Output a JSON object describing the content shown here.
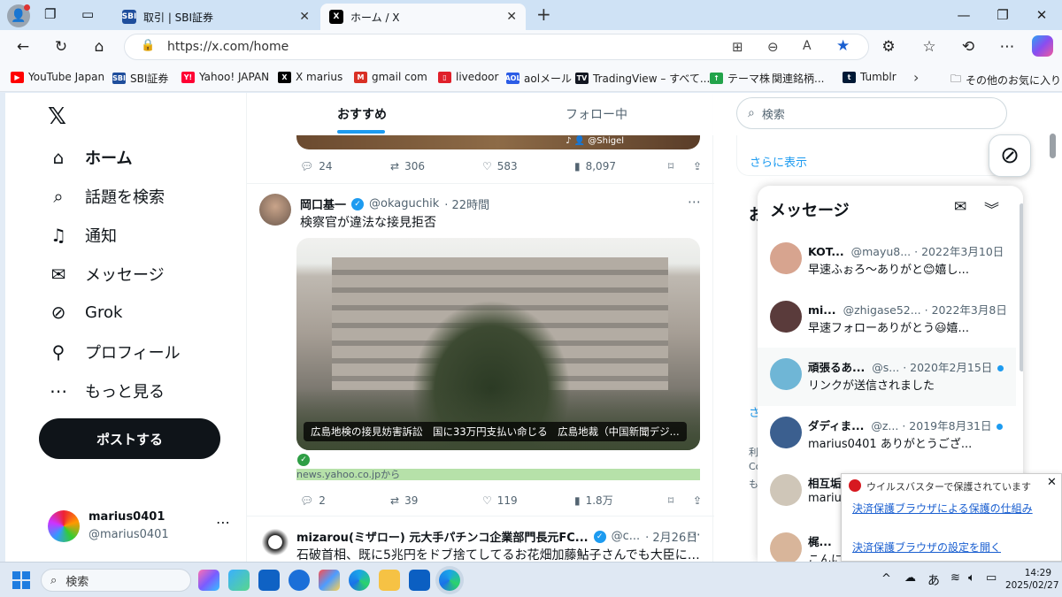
{
  "browser": {
    "tabs": [
      {
        "label": "取引 | SBI証券",
        "fav": "SBI"
      },
      {
        "label": "ホーム / X",
        "fav": "X"
      }
    ],
    "url": "https://x.com/home",
    "favorites": [
      {
        "label": "YouTube Japan",
        "icon": "youtube-icon",
        "color": "#ff0000",
        "glyph": "▶"
      },
      {
        "label": "SBI証券",
        "icon": "sbi-icon",
        "color": "#1f4e9c",
        "glyph": "SBI"
      },
      {
        "label": "Yahoo! JAPAN",
        "icon": "yahoo-icon",
        "color": "#ff0033",
        "glyph": "Y!"
      },
      {
        "label": "X marius",
        "icon": "x-icon",
        "color": "#000000",
        "glyph": "X"
      },
      {
        "label": "gmail com",
        "icon": "gmail-icon",
        "color": "#d93025",
        "glyph": "M"
      },
      {
        "label": "livedoor",
        "icon": "livedoor-icon",
        "color": "#e0202a",
        "glyph": "▯"
      },
      {
        "label": "aolメール",
        "icon": "aol-icon",
        "color": "#2b5ce6",
        "glyph": "AOL"
      },
      {
        "label": "TradingView – すべて...",
        "icon": "tradingview-icon",
        "color": "#131722",
        "glyph": "TV"
      },
      {
        "label": "テーマ株",
        "icon": "theme-stock-icon",
        "color": "#22a34a",
        "glyph": "↑"
      },
      {
        "label": "関連銘柄...",
        "icon": "",
        "color": "",
        "glyph": ""
      },
      {
        "label": "Tumblr",
        "icon": "tumblr-icon",
        "color": "#001935",
        "glyph": "t"
      }
    ],
    "other_favorites": "その他のお気に入り"
  },
  "sidebar": {
    "items": [
      {
        "label": "ホーム",
        "icon": "home-icon",
        "glyph": "⌂"
      },
      {
        "label": "話題を検索",
        "icon": "search-icon",
        "glyph": "⌕"
      },
      {
        "label": "通知",
        "icon": "bell-icon",
        "glyph": "♫"
      },
      {
        "label": "メッセージ",
        "icon": "mail-icon",
        "glyph": "✉"
      },
      {
        "label": "Grok",
        "icon": "grok-icon",
        "glyph": "⊘"
      },
      {
        "label": "プロフィール",
        "icon": "person-icon",
        "glyph": "⚲"
      },
      {
        "label": "もっと見る",
        "icon": "more-circle-icon",
        "glyph": "⋯"
      }
    ],
    "post_button": "ポストする",
    "account": {
      "name": "marius0401",
      "handle": "@marius0401"
    }
  },
  "feed": {
    "tabs": [
      "おすすめ",
      "フォロー中"
    ],
    "prev_post": {
      "watermark": "♪ 👤 @Shigel",
      "replies": "24",
      "reposts": "306",
      "likes": "583",
      "views": "8,097"
    },
    "post1": {
      "name": "岡口基一",
      "handle": "@okaguchik",
      "time": "· 22時間",
      "text": "検察官が違法な接見拒否",
      "card_caption": "広島地検の接見妨害訴訟　国に33万円支払い命じる　広島地裁（中国新聞デジ...",
      "card_source": "news.yahoo.co.jpから",
      "replies": "2",
      "reposts": "39",
      "likes": "119",
      "views": "1.8万"
    },
    "post2": {
      "name": "mizarou(ミザロー) 元大手パチンコ企業部門長元FC...",
      "handle": "@c...",
      "time": "· 2月26日",
      "text": "石破首相、既に5兆円をドブ捨てしてるお花畑加藤鮎子さんでも大臣に居座れ"
    }
  },
  "right": {
    "search_placeholder": "検索",
    "show_more": "さらに表示",
    "messages": {
      "title": "メッセージ",
      "items": [
        {
          "name": "KOT...",
          "handle": "@mayu8...",
          "date": "· 2022年3月10日",
          "preview": "早速ふぉろ～ありがと😊嬉し...",
          "unread": false,
          "avatar_color": "#d7a48f"
        },
        {
          "name": "mi...",
          "handle": "@zhigase52...",
          "date": "· 2022年3月8日",
          "preview": "早速フォローありがとう😃嬉...",
          "unread": false,
          "avatar_color": "#5a3b3b"
        },
        {
          "name": "頑張るあ...",
          "handle": "@s...",
          "date": "· 2020年2月15日",
          "preview": "リンクが送信されました",
          "unread": true,
          "avatar_color": "#6fb6d6"
        },
        {
          "name": "ダディま...",
          "handle": "@z...",
          "date": "· 2019年8月31日",
          "preview": "marius0401 ありがとうござ...",
          "unread": true,
          "avatar_color": "#3b5f8f"
        },
        {
          "name": "相互垢...",
          "handle": "",
          "date": "",
          "preview": "marius",
          "unread": false,
          "avatar_color": "#cfc6b8"
        },
        {
          "name": "梶...",
          "handle": "",
          "date": "",
          "preview": "こんに",
          "unread": false,
          "avatar_color": "#d8b59a"
        }
      ]
    },
    "side_texts": [
      "お",
      "さ",
      "利",
      "Co",
      "も"
    ]
  },
  "notification": {
    "title": "ウイルスバスターで保護されています",
    "link1": "決済保護ブラウザによる保護の仕組み",
    "link2": "決済保護ブラウザの設定を開く"
  },
  "taskbar": {
    "search": "検索",
    "ime": "あ",
    "time": "14:29",
    "date": "2025/02/27"
  }
}
